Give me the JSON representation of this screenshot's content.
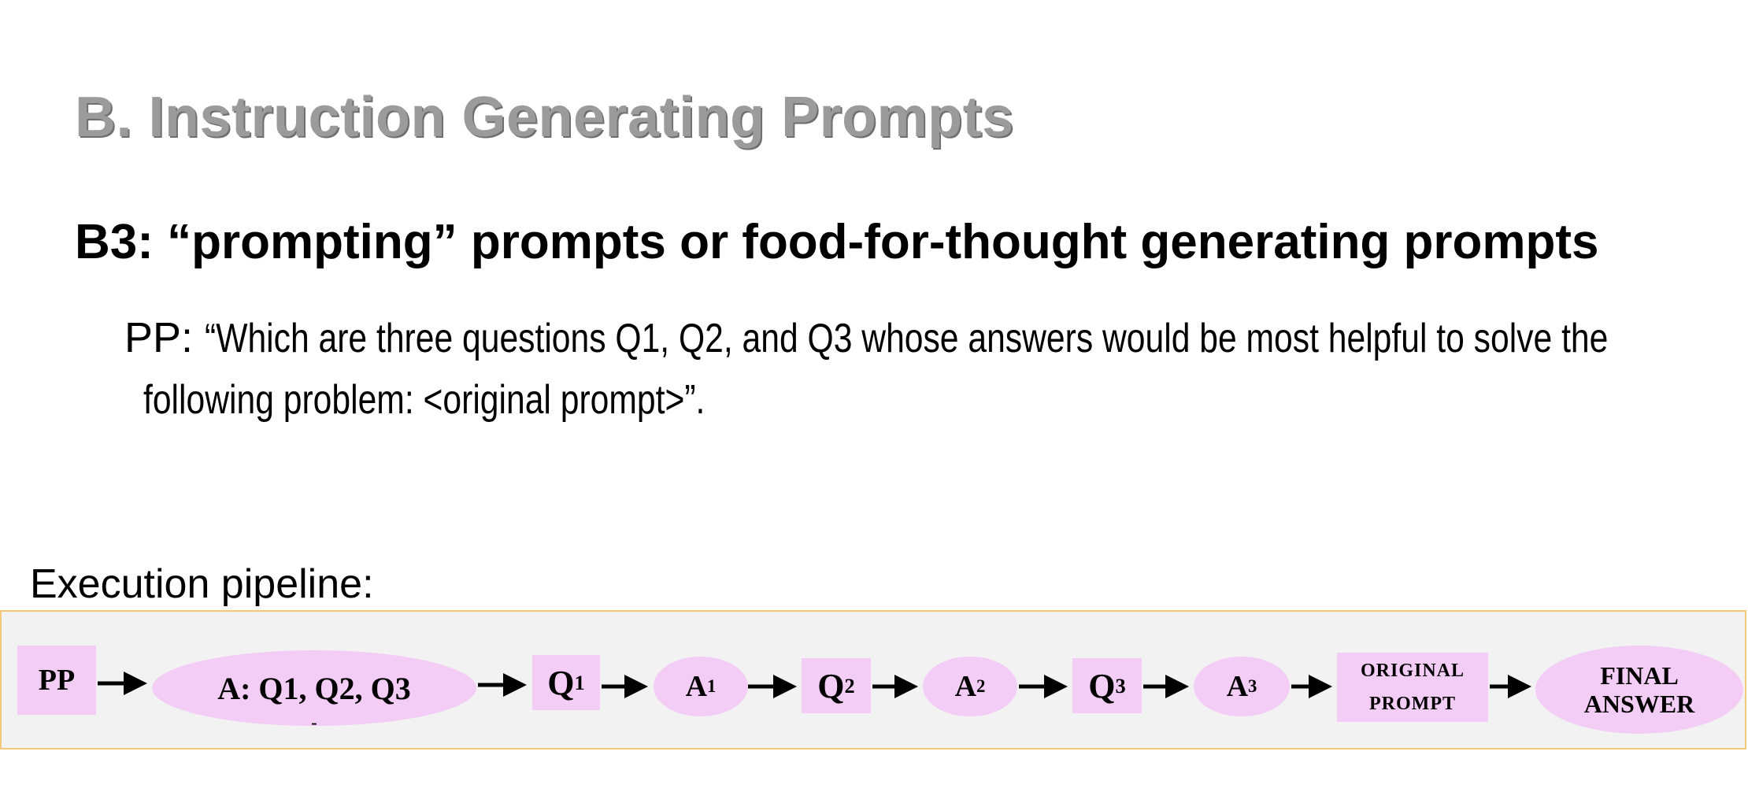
{
  "title": "B. Instruction Generating Prompts",
  "subtitle": "B3: “prompting” prompts or food-for-thought generating prompts",
  "pp": {
    "label": "PP:",
    "text_line1": "“Which are three questions Q1, Q2, and Q3 whose answers would be most helpful to solve the",
    "text_line2": "following problem:  <original prompt>”."
  },
  "pipeline": {
    "label": "Execution pipeline:",
    "nodes": [
      {
        "id": "pp",
        "text": "PP",
        "shape": "rect"
      },
      {
        "id": "a-questions",
        "text": "A: Q1, Q2, Q3",
        "shape": "ellipse"
      },
      {
        "id": "q1",
        "base": "Q",
        "sub": "1",
        "shape": "rect"
      },
      {
        "id": "a1",
        "base": "A",
        "sub": "1",
        "shape": "ellipse"
      },
      {
        "id": "q2",
        "base": "Q",
        "sub": "2",
        "shape": "rect"
      },
      {
        "id": "a2",
        "base": "A",
        "sub": "2",
        "shape": "ellipse"
      },
      {
        "id": "q3",
        "base": "Q",
        "sub": "3",
        "shape": "rect"
      },
      {
        "id": "a3",
        "base": "A",
        "sub": "3",
        "shape": "ellipse"
      },
      {
        "id": "original-prompt",
        "line1": "ORIGINAL",
        "line2": "PROMPT",
        "shape": "rect"
      },
      {
        "id": "final-answer",
        "line1": "FINAL",
        "line2": "ANSWER",
        "shape": "ellipse"
      }
    ],
    "dash_mark": "-",
    "colors": {
      "node_fill": "#f3cdf5",
      "band_fill": "#f2f2f2",
      "band_border": "#f4c97a"
    }
  }
}
